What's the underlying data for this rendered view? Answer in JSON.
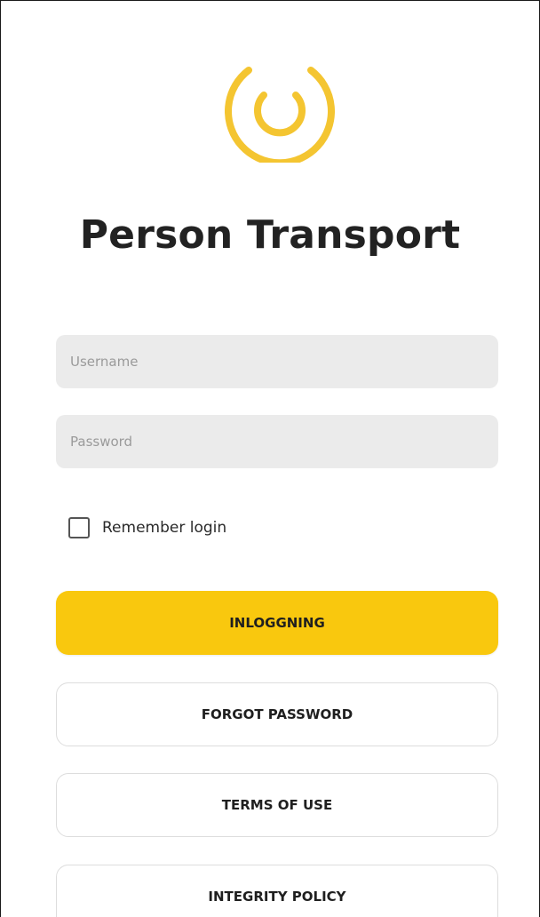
{
  "app": {
    "title": "Person Transport",
    "logo_icon": "power-ring-icon",
    "accent_color": "#f9c80e"
  },
  "form": {
    "username_placeholder": "Username",
    "password_placeholder": "Password",
    "remember_label": "Remember login",
    "remember_checked": false
  },
  "buttons": {
    "login_label": "INLOGGNING",
    "forgot_label": "FORGOT PASSWORD",
    "terms_label": "TERMS OF USE",
    "policy_label": "INTEGRITY POLICY"
  }
}
